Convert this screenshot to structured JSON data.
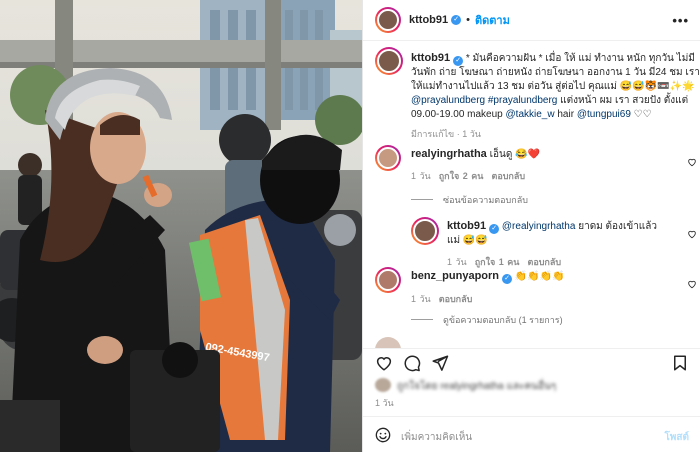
{
  "post": {
    "username": "kttob91",
    "verified_mark": "✓",
    "separator": "•",
    "follow_label": "ติดตาม",
    "more_label": "•••",
    "caption": {
      "username": "kttob91",
      "text_1": " * มันคือความฝัน * เมื่อ ให้ แม่ ทำงาน หนัก ทุกวัน ไม่มีวันพัก ถ่าย โฆษณา ถ่ายหนัง ถ่ายโฆษนา ออกงาน 1 วัน มี24 ชม เราให้แม่ทำงานไปแล้ว 13 ชม ต่อวัน สู่ต่อไป คุณแม่ 😅😅🐯📼✨🌟 ",
      "tag_1": "@prayalundberg",
      "tag_2": "#prayalundberg",
      "text_2": " แต่งหน้า ผม เรา สวยปัง ตั้งแต่ 09.00-19.00 makeup ",
      "tag_3": "@takkie_w",
      "text_3": " hair ",
      "tag_4": "@tungpui69",
      "text_4": " ♡♡",
      "meta": "มีการแก้ไข · 1 วัน"
    },
    "comments": [
      {
        "username": "realyingrhatha",
        "text": "เอ็นดู 😂❤️",
        "time": "1 วัน",
        "likes": "ถูกใจ 2 คน",
        "reply": "ตอบกลับ"
      },
      {
        "username": "kttob91",
        "mention": "@realyingrhatha",
        "text": " ยาดม ต้องเข้าแล้วแม่ 😅😅",
        "time": "1 วัน",
        "likes": "ถูกใจ 1 คน",
        "reply": "ตอบกลับ"
      },
      {
        "username": "benz_punyaporn",
        "text": "👏👏👏👏",
        "time": "1 วัน",
        "reply": "ตอบกลับ"
      }
    ],
    "hide_replies": "ซ่อนข้อความตอบกลับ",
    "view_replies": "ดูข้อความตอบกลับ (1 รายการ)",
    "likes_blurred": "ถูกใจโดย realyingrhatha และคนอื่นๆ",
    "date": "1 วัน",
    "add_comment_placeholder": "เพิ่มความคิดเห็น",
    "post_label": "โพสต์",
    "photo_vest_text": "092-4543997"
  },
  "colors": {
    "link": "#0095f6",
    "tag": "#00376b",
    "meta": "#8e8e8e",
    "heart_red": "#ed4956"
  },
  "icons": [
    "heart-icon",
    "comment-icon",
    "share-icon",
    "bookmark-icon",
    "emoji-icon",
    "more-icon",
    "verified-icon"
  ]
}
